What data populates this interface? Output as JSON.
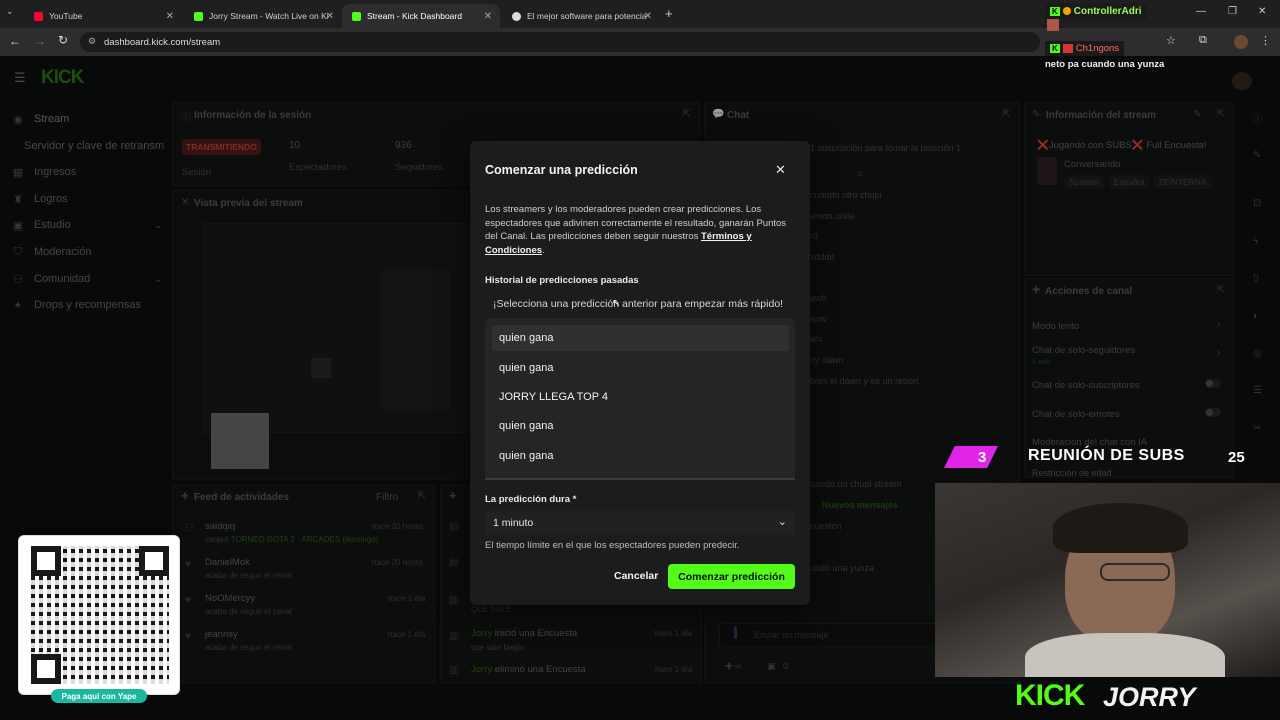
{
  "browser": {
    "tabs": [
      {
        "title": "YouTube",
        "favicon_color": "#ff0033"
      },
      {
        "title": "Jorry Stream - Watch Live on Ki",
        "favicon_color": "#53fc18"
      },
      {
        "title": "Stream - Kick Dashboard",
        "favicon_color": "#53fc18"
      },
      {
        "title": "El mejor software para potencia",
        "favicon_color": "#dddddd"
      }
    ],
    "url": "dashboard.kick.com/stream"
  },
  "kick_logo": "KICK",
  "sidebar": {
    "items": [
      {
        "label": "Stream",
        "icon": "broadcast-icon"
      },
      {
        "label": "Servidor y clave de retransm",
        "icon": ""
      },
      {
        "label": "Ingresos",
        "icon": "money-icon"
      },
      {
        "label": "Logros",
        "icon": "trophy-icon"
      },
      {
        "label": "Estudio",
        "icon": "studio-icon"
      },
      {
        "label": "Moderación",
        "icon": "shield-icon"
      },
      {
        "label": "Comunidad",
        "icon": "community-icon"
      },
      {
        "label": "Drops y recompensas",
        "icon": "gift-icon"
      }
    ]
  },
  "session": {
    "title": "Información de la sesión",
    "status_badge": "TRANSMITIENDO",
    "session_label": "Sesión",
    "viewers_value": "10",
    "viewers_label": "Espectadores",
    "followers_value": "936",
    "followers_label": "Seguidores"
  },
  "preview": {
    "title": "Vista previa del stream"
  },
  "activity_feed": {
    "title": "Feed de actividades",
    "filter": "Filtro",
    "rows": [
      {
        "name": "saidqiq",
        "time": "hace 20 horas",
        "text": "canjeó",
        "highlight": "TORNEO DOTA 2 - ARCADES (domingo)"
      },
      {
        "name": "DanielMok",
        "time": "hace 20 horas",
        "text": "acaba de seguir el canal",
        "highlight": ""
      },
      {
        "name": "NoOMercyy",
        "time": "hace 1 día",
        "text": "acaba de seguir el canal",
        "highlight": ""
      },
      {
        "name": "jeannsy",
        "time": "hace 1 día",
        "text": "acaba de seguir el canal",
        "highlight": ""
      }
    ]
  },
  "feed2": {
    "rows": [
      {
        "prefix": "",
        "text": "QUE SALE",
        "time": ""
      },
      {
        "prefix": "Jorry",
        "text": "inició una Encuesta",
        "sub": "que sale biejtio",
        "time": "hace 1 día"
      },
      {
        "prefix": "Jorry",
        "text": "eliminó una Encuesta",
        "sub": "",
        "time": "hace 1 día"
      }
    ]
  },
  "chat": {
    "title": "Chat",
    "lines": [
      "1 suscripción para tomar la posición 1",
      "cuando otro chupi",
      "emon unite",
      "rd",
      "xdddd",
      "awb",
      "anw",
      "ahi",
      "oy dawn",
      "bres el dawn y es un report",
      "uando un chupi stream",
      "Nuevos mensajes",
      "cuestón",
      "undo una yunza"
    ],
    "placeholder": "Enviar un mensaje",
    "counter": "0"
  },
  "stream_info": {
    "title": "Información del stream",
    "stream_title": "❌Jugando con SUBS❌ Full Encuesta!",
    "category": "Conversando",
    "tags": [
      "Spanish",
      "Español",
      "ZEINTERNA"
    ]
  },
  "channel_actions": {
    "title": "Acciones de canal",
    "items": [
      {
        "label": "Modo lento",
        "sub": "",
        "control": "chevron"
      },
      {
        "label": "Chat de solo-seguidores",
        "sub": "1 min",
        "control": "chevron"
      },
      {
        "label": "Chat de solo-suscriptores",
        "sub": "",
        "control": "toggle"
      },
      {
        "label": "Chat de solo-emotes",
        "sub": "",
        "control": "toggle"
      },
      {
        "label": "Moderación del chat con IA",
        "sub": "",
        "control": "external"
      },
      {
        "label": "Restricción de edad",
        "sub": "",
        "control": "chevron"
      }
    ]
  },
  "modal": {
    "title": "Comenzar una predicción",
    "description": "Los streamers y los moderadores pueden crear predicciones. Los espectadores que adivinen correctamente el resultado, ganarán Puntos del Canal. Las predicciones deben seguir nuestros",
    "terms_link": "Términos y Condiciones",
    "terms_suffix": ".",
    "history_label": "Historial de predicciones pasadas",
    "history_placeholder": "¡Selecciona una predicción anterior para empezar más rápido!",
    "history_options": [
      "quien gana",
      "quien gana",
      "JORRY LLEGA TOP 4",
      "quien gana",
      "quien gana"
    ],
    "duration_label": "La predicción dura *",
    "duration_value": "1 minuto",
    "duration_help": "El tiempo límite en el que los espectadores pueden predecir.",
    "cancel": "Cancelar",
    "submit": "Comenzar predicción"
  },
  "overlay": {
    "user_top": "ControllerAdri",
    "user_chat_name": "Ch1ngons",
    "user_chat_msg": "neto pa cuando una yunza",
    "subs_left": "3",
    "subs_title": "REUNIÓN DE SUBS",
    "subs_right": "25",
    "qr_caption": "Paga aquí con Yape",
    "brand_kick": "KICK",
    "brand_name": "JORRY"
  },
  "colors": {
    "kick_green": "#53fc18",
    "live_red": "#e53935",
    "magenta": "#e024e8"
  }
}
